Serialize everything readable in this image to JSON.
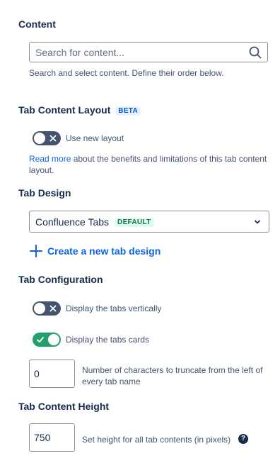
{
  "content": {
    "title": "Content",
    "search_placeholder": "Search for content...",
    "help": "Search and select content. Define their order below."
  },
  "layout": {
    "title": "Tab Content Layout",
    "badge": "BETA",
    "toggle_label": "Use new layout",
    "toggle_on": false,
    "read_more": "Read more",
    "help_rest": " about the benefits and limitations of this tab content layout."
  },
  "design": {
    "title": "Tab Design",
    "selected": "Confluence Tabs",
    "selected_badge": "DEFAULT",
    "create_label": "Create a new tab design"
  },
  "config": {
    "title": "Tab Configuration",
    "vertical_label": "Display the tabs vertically",
    "vertical_on": false,
    "cards_label": "Display the tabs cards",
    "cards_on": true,
    "truncate_value": "0",
    "truncate_help": "Number of characters to truncate from the left of every tab name"
  },
  "height": {
    "title": "Tab Content Height",
    "value": "750",
    "help": "Set height for all tab contents (in pixels)",
    "help_icon": "?"
  },
  "colors": {
    "link": "#0c66e4",
    "toggle_off": "#44546f",
    "toggle_on": "#22a06b"
  }
}
